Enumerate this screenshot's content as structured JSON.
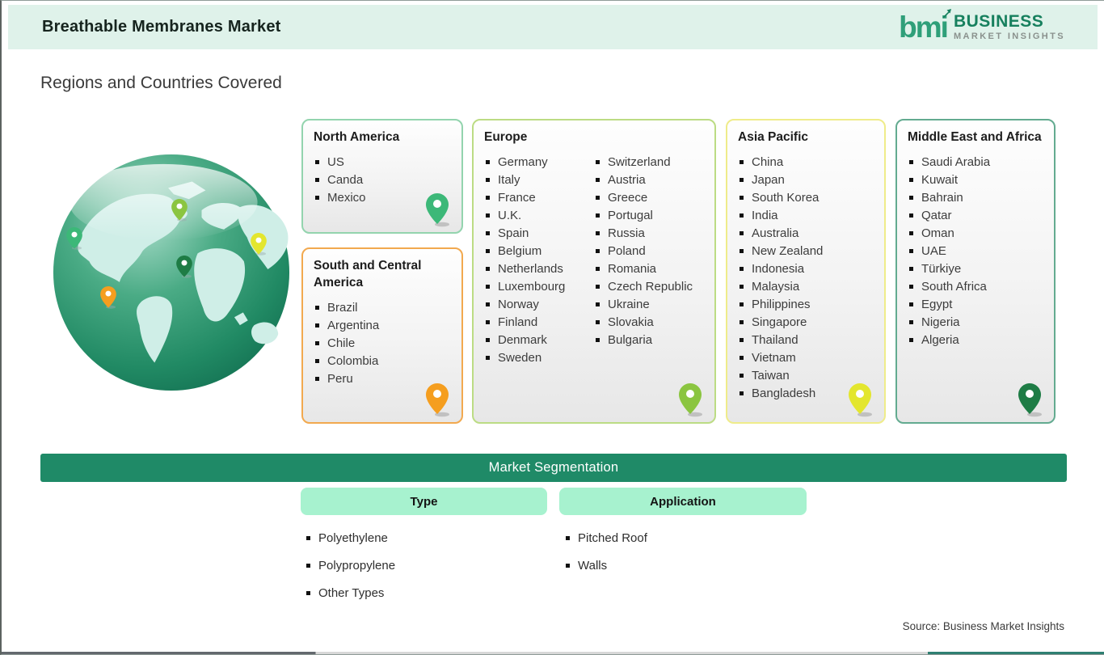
{
  "header": {
    "title": "Breathable Membranes Market",
    "logo": {
      "mark": "bmi",
      "line1": "BUSINESS",
      "line2": "MARKET INSIGHTS"
    }
  },
  "section_title": "Regions and Countries Covered",
  "regions": [
    {
      "name": "North America",
      "border_color": "#93d4ae",
      "pin_color": "#3cb878",
      "countries": [
        "US",
        "Canda",
        "Mexico"
      ]
    },
    {
      "name": "South and Central America",
      "border_color": "#f2a94f",
      "pin_color": "#f59e1f",
      "countries": [
        "Brazil",
        "Argentina",
        "Chile",
        "Colombia",
        "Peru"
      ]
    },
    {
      "name": "Europe",
      "border_color": "#bcdc84",
      "pin_color": "#8bc540",
      "countries": [
        "Germany",
        "Italy",
        "France",
        "U.K.",
        "Spain",
        "Belgium",
        "Netherlands",
        "Luxembourg",
        "Norway",
        "Finland",
        "Denmark",
        "Sweden",
        "Switzerland",
        "Austria",
        "Greece",
        "Portugal",
        "Russia",
        "Poland",
        "Romania",
        "Czech Republic",
        "Ukraine",
        "Slovakia",
        "Bulgaria"
      ]
    },
    {
      "name": "Asia Pacific",
      "border_color": "#efec8a",
      "pin_color": "#e3e62e",
      "countries": [
        "China",
        "Japan",
        "South Korea",
        "India",
        "Australia",
        "New Zealand",
        "Indonesia",
        "Malaysia",
        "Philippines",
        "Singapore",
        "Thailand",
        "Vietnam",
        "Taiwan",
        "Bangladesh"
      ]
    },
    {
      "name": "Middle East and Africa",
      "border_color": "#63ab90",
      "pin_color": "#1e7c45",
      "countries": [
        "Saudi Arabia",
        "Kuwait",
        "Bahrain",
        "Qatar",
        "Oman",
        "UAE",
        "Türkiye",
        "South Africa",
        "Egypt",
        "Nigeria",
        "Algeria"
      ]
    }
  ],
  "segmentation": {
    "title": "Market Segmentation",
    "bar_color": "#1f8a67",
    "tab_bg": "#a7f2cf",
    "columns": [
      {
        "label": "Type",
        "items": [
          "Polyethylene",
          "Polypropylene",
          "Other Types"
        ]
      },
      {
        "label": "Application",
        "items": [
          "Pitched Roof",
          "Walls"
        ]
      }
    ]
  },
  "source_note": "Source: Business Market Insights",
  "colors": {
    "header_bg": "#dff2ea",
    "brand_green": "#2f9f79"
  }
}
